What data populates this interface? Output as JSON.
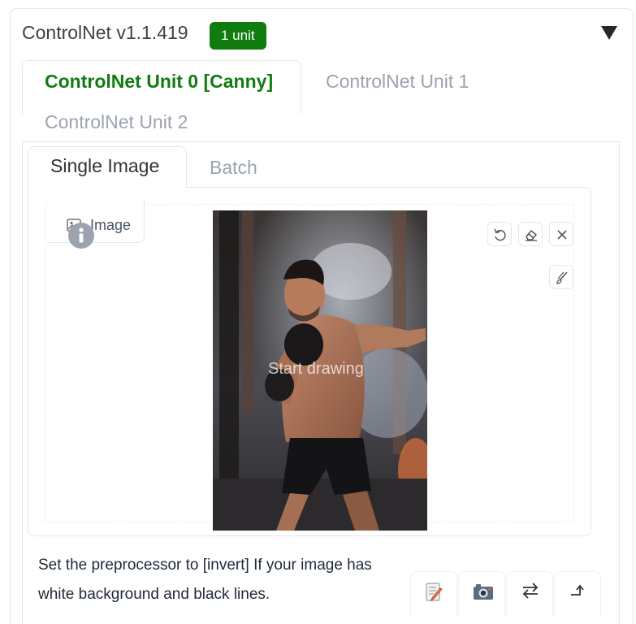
{
  "panel": {
    "title": "ControlNet v1.1.419",
    "badge": "1 unit",
    "collapse_icon": "triangle-down-icon"
  },
  "unit_tabs": [
    {
      "label": "ControlNet Unit 0 [Canny]",
      "active": true
    },
    {
      "label": "ControlNet Unit 1",
      "active": false
    },
    {
      "label": "ControlNet Unit 2",
      "active": false
    }
  ],
  "mode_tabs": [
    {
      "label": "Single Image",
      "active": true
    },
    {
      "label": "Batch",
      "active": false
    }
  ],
  "image_input": {
    "label": "Image",
    "label_icon": "image-icon",
    "info_icon": "info-icon",
    "canvas_hint": "Start drawing",
    "photo_icon": "boxer-photo",
    "tools": [
      "undo-icon",
      "eraser-icon",
      "close-icon",
      "brush-icon"
    ]
  },
  "hint": "Set the preprocessor to [invert] If your image has white background and black lines.",
  "actions": [
    "edit-icon",
    "camera-icon",
    "swap-icon",
    "send-icon"
  ],
  "colors": {
    "accent": "#107c10",
    "inactive_text": "#9ca3af",
    "border": "#e5e7eb"
  }
}
